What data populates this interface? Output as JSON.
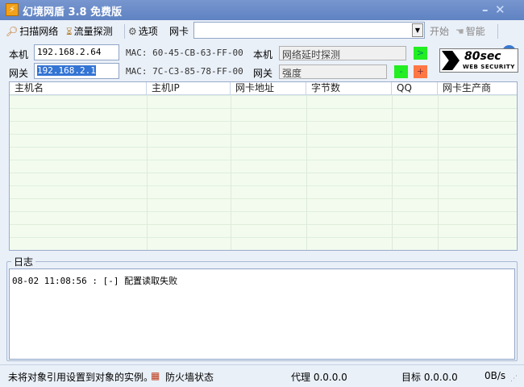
{
  "window": {
    "title": "幻境网盾 3.8 免费版",
    "minimize": "–",
    "close": "✕"
  },
  "toolbar": {
    "scan": "扫描网络",
    "traffic": "流量探测",
    "options": "选项",
    "nic_label": "网卡",
    "nic_value": "",
    "start": "开始",
    "smart": "智能",
    "help": "?"
  },
  "local": {
    "label": "本机",
    "ip": "192.168.2.64",
    "mac": "MAC: 60-45-CB-63-FF-00",
    "right_label": "本机",
    "right_value": "网络延时探测",
    "go": ">"
  },
  "gateway": {
    "label": "网关",
    "ip": "192.168.2.1",
    "mac": "MAC: 7C-C3-85-78-FF-00",
    "right_label": "网关",
    "right_value": "强度",
    "minus": "-",
    "plus": "+"
  },
  "brand": {
    "logo_text": "80sec",
    "logo_sub": "WEB SECURITY"
  },
  "table": {
    "columns": [
      "主机名",
      "主机IP",
      "网卡地址",
      "字节数",
      "QQ",
      "网卡生产商"
    ],
    "rows": []
  },
  "log": {
    "title": "日志",
    "entries": [
      "08-02 11:08:56 : [-] 配置读取失败"
    ]
  },
  "status": {
    "message": "未将对象引用设置到对象的实例。",
    "firewall": "防火墙状态",
    "proxy": "代理 0.0.0.0",
    "target": "目标 0.0.0.0",
    "speed": "0B/s"
  },
  "colors": {
    "title_bar": "#6a8cc8",
    "go": "#22ee22",
    "minus": "#22ee22",
    "plus": "#ff7744"
  }
}
